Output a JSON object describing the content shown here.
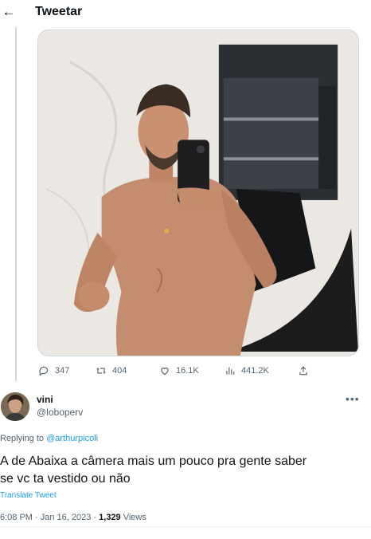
{
  "header": {
    "back_icon": "arrow-left-icon",
    "title": "Tweetar"
  },
  "media": {
    "image": "mirror-selfie-photo"
  },
  "actions": {
    "replies": "347",
    "retweets": "404",
    "likes": "16.1K",
    "views": "441.2K"
  },
  "reply": {
    "display_name": "vini",
    "handle": "@loboperv",
    "replying_prefix": "Replying to",
    "replying_to": "@arthurpicoli",
    "text_line1": "A de Abaixa a câmera mais um pouco pra gente saber",
    "text_line2": "se vc ta vestido ou não",
    "translate_label": "Translate Tweet",
    "timestamp": "6:08 PM · Jan 16, 2023 · ",
    "views_count": "1,329",
    "views_label": " Views"
  },
  "colors": {
    "accent": "#1d9bf0",
    "secondary_text": "#536471",
    "border": "#cfd9de"
  }
}
